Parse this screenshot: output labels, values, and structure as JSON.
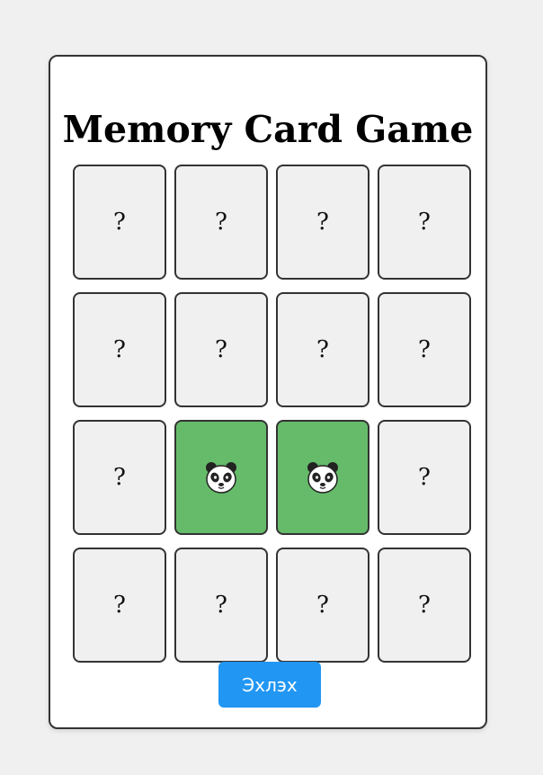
{
  "title": "Memory Card Game",
  "start_button_label": "Эхлэх",
  "colors": {
    "matched": "#66bb6a",
    "hidden": "#f0f0f0",
    "button": "#2196f3"
  },
  "cards": [
    {
      "state": "hidden",
      "face": "?"
    },
    {
      "state": "hidden",
      "face": "?"
    },
    {
      "state": "hidden",
      "face": "?"
    },
    {
      "state": "hidden",
      "face": "?"
    },
    {
      "state": "hidden",
      "face": "?"
    },
    {
      "state": "hidden",
      "face": "?"
    },
    {
      "state": "hidden",
      "face": "?"
    },
    {
      "state": "hidden",
      "face": "?"
    },
    {
      "state": "hidden",
      "face": "?"
    },
    {
      "state": "matched",
      "icon": "panda-icon"
    },
    {
      "state": "matched",
      "icon": "panda-icon"
    },
    {
      "state": "hidden",
      "face": "?"
    },
    {
      "state": "hidden",
      "face": "?"
    },
    {
      "state": "hidden",
      "face": "?"
    },
    {
      "state": "hidden",
      "face": "?"
    },
    {
      "state": "hidden",
      "face": "?"
    }
  ]
}
